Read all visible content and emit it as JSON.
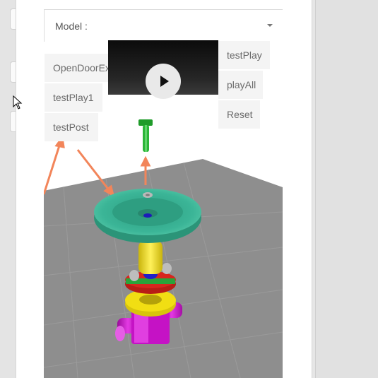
{
  "model_select": {
    "label": "Model :"
  },
  "buttons": {
    "open_door": "OpenDoorEx",
    "test_play1": "testPlay1",
    "test_post": "testPost",
    "test_play": "testPlay",
    "play_all": "playAll",
    "reset": "Reset"
  },
  "video": {
    "state": "paused",
    "icon": "play-icon"
  },
  "scene": {
    "colors": {
      "floor": "#8e8e8e",
      "handwheel": "#3bb597",
      "stem": "#f1de13",
      "flange_red": "#d7261e",
      "flange_green": "#2aa33a",
      "body": "#cc11cc",
      "bolt": "#1f9b2a",
      "arrow": "#f2855a"
    }
  }
}
